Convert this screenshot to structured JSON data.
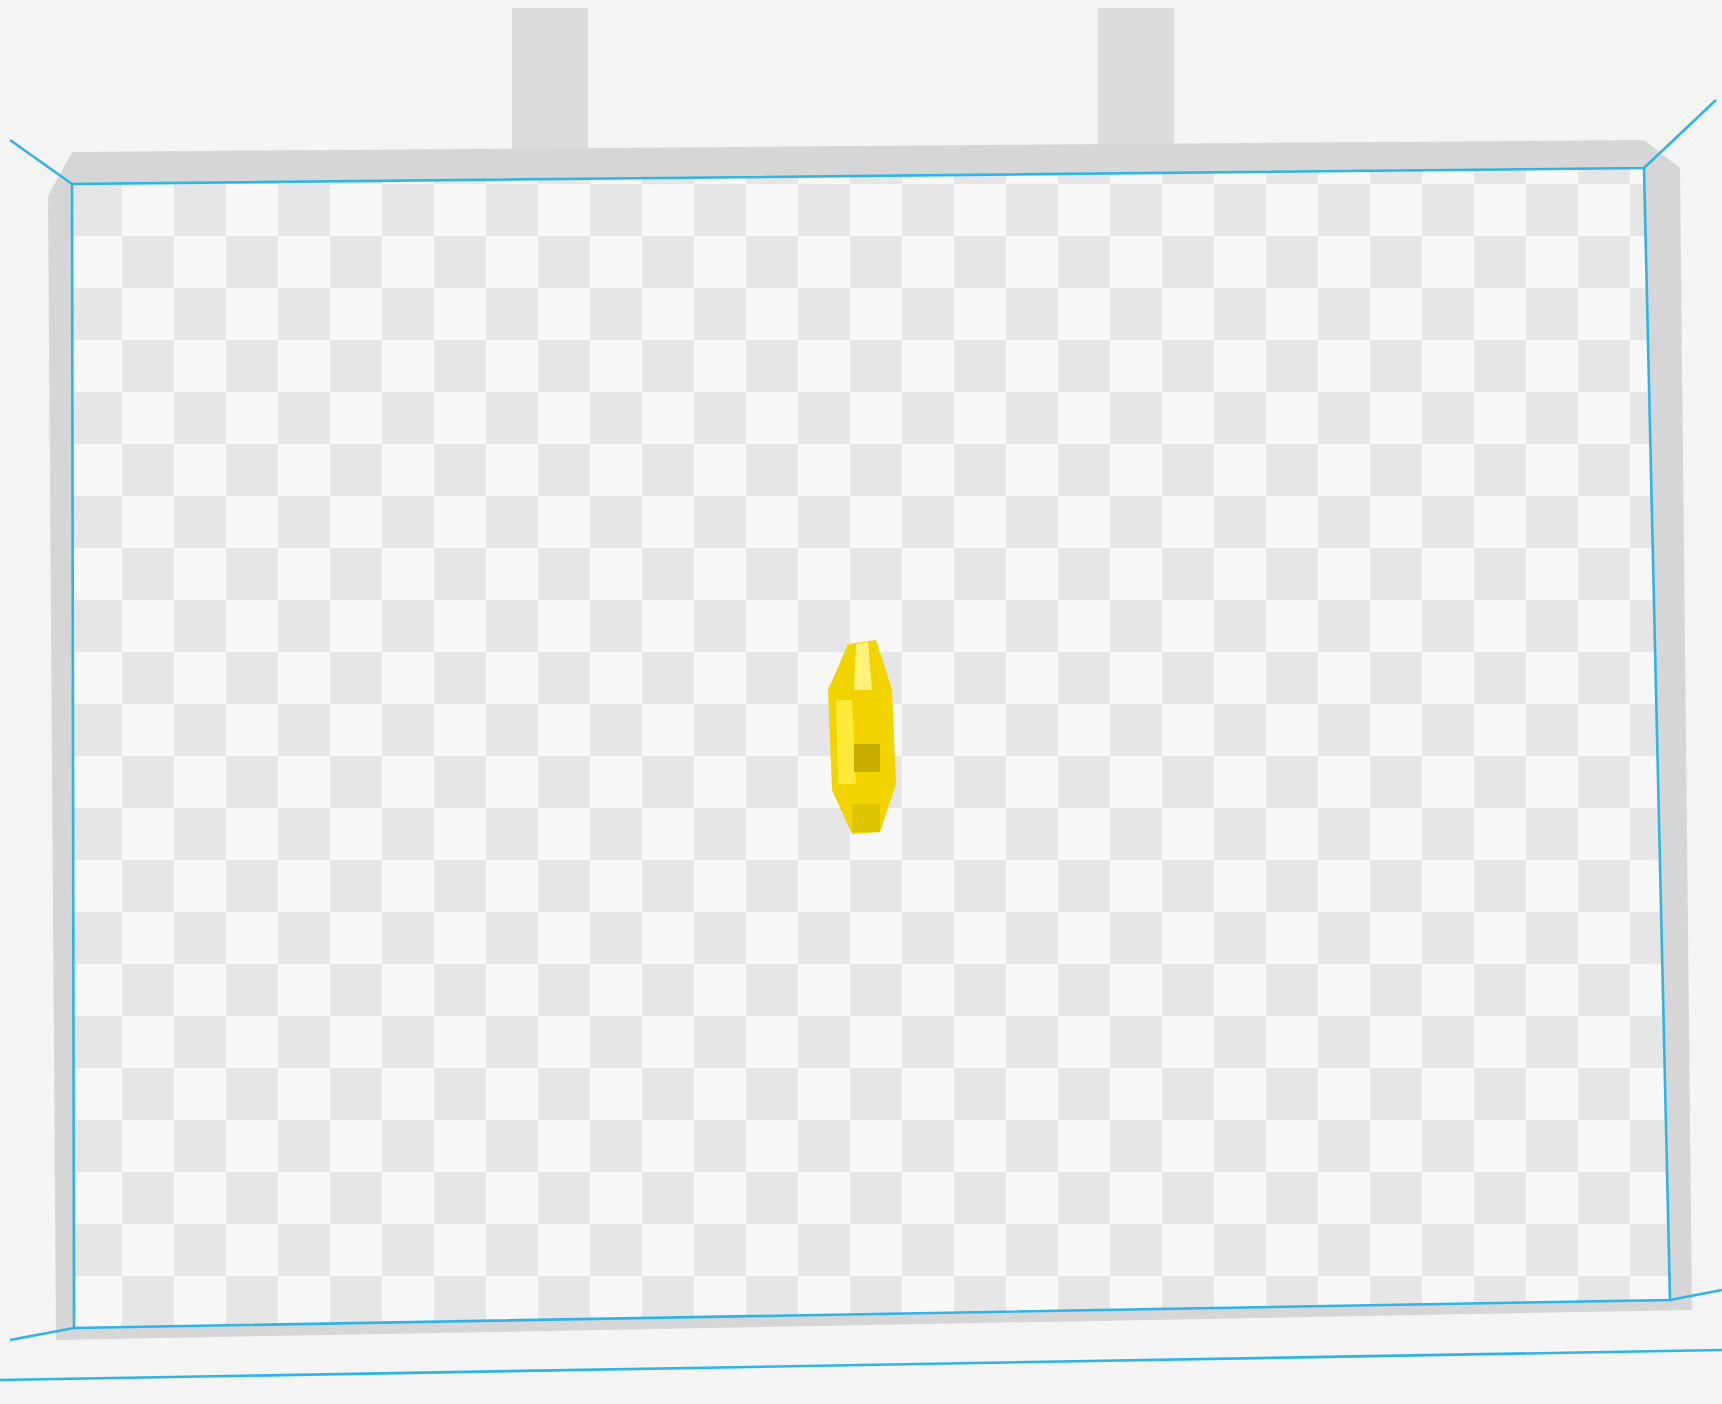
{
  "viewport": {
    "kind": "build-plate"
  },
  "models": [
    {
      "kind": "part"
    }
  ]
}
